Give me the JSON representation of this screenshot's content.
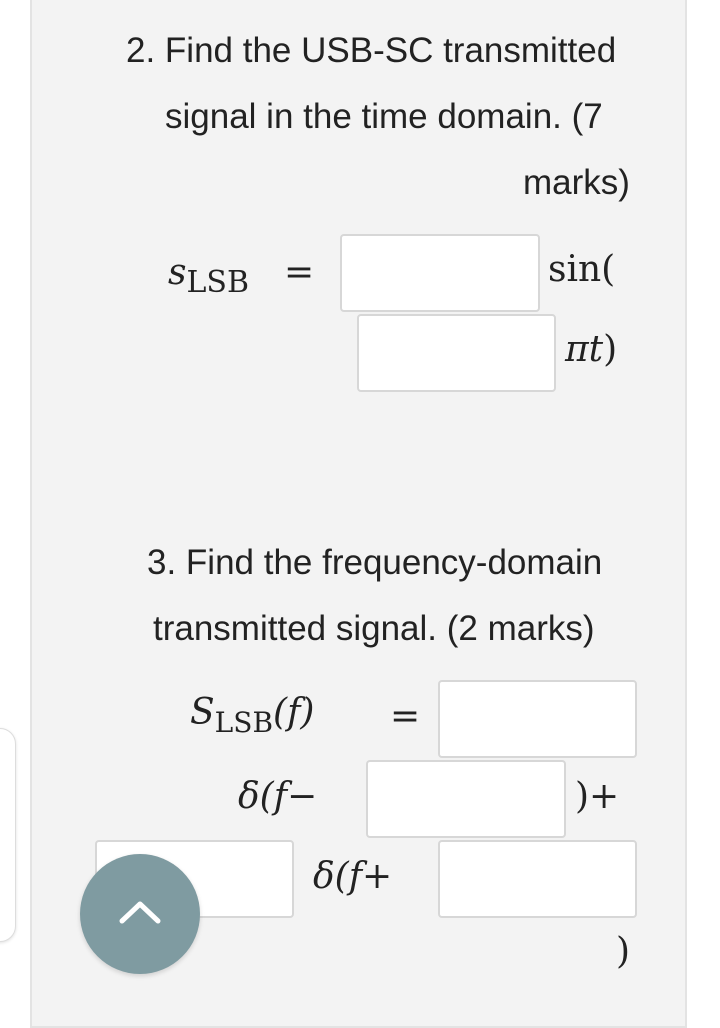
{
  "question2": {
    "line1": "2. Find the USB-SC transmitted",
    "line2": "signal in the time domain. (7",
    "line3": "marks)",
    "lhs": "s",
    "lhs_sub": "LSB",
    "equals": "=",
    "sin_text": "sin(",
    "pi_t": "πt",
    "close_paren": ")"
  },
  "question3": {
    "line1": "3. Find the frequency-domain",
    "line2": "transmitted signal. (2 marks)",
    "lhs": "S",
    "lhs_sub": "LSB",
    "lhs_arg": "(f)",
    "equals": "=",
    "delta_minus": "δ(f−",
    "plus_close": ")+",
    "delta_plus": "δ(f+",
    "final_paren": ")"
  },
  "nav": {
    "icon": "chevron-up-icon",
    "fab_color": "#7f9ba1"
  }
}
